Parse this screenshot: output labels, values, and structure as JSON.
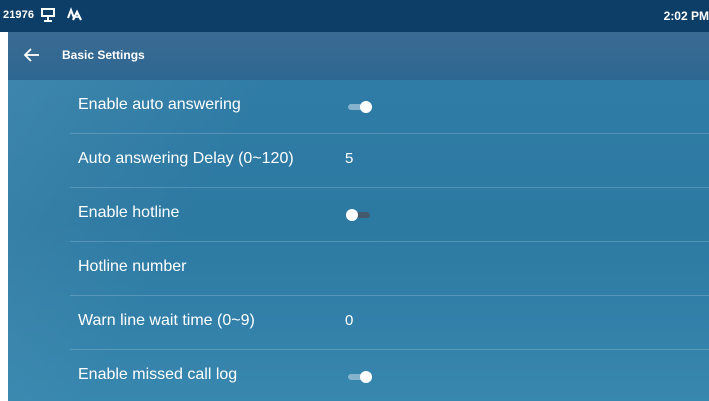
{
  "status_bar": {
    "id_text": "21976",
    "icons": [
      "network-icon",
      "font-a-icon"
    ],
    "time": "2:02 PM"
  },
  "header": {
    "title": "Basic Settings",
    "back_icon": "back-arrow-icon"
  },
  "settings": [
    {
      "label": "Enable auto answering",
      "type": "toggle",
      "state": "on"
    },
    {
      "label": "Auto answering Delay (0~120)",
      "type": "value",
      "value": "5"
    },
    {
      "label": "Enable hotline",
      "type": "toggle",
      "state": "off"
    },
    {
      "label": "Hotline number",
      "type": "value",
      "value": ""
    },
    {
      "label": "Warn line wait time (0~9)",
      "type": "value",
      "value": "0"
    },
    {
      "label": "Enable missed call log",
      "type": "toggle",
      "state": "on"
    }
  ],
  "colors": {
    "status_bar": "#0d3e67",
    "title_bar": "#316891",
    "content_bg": "#2f7ca6",
    "toggle_on_track": "#86b2cc",
    "toggle_off_track": "#465a6d"
  }
}
